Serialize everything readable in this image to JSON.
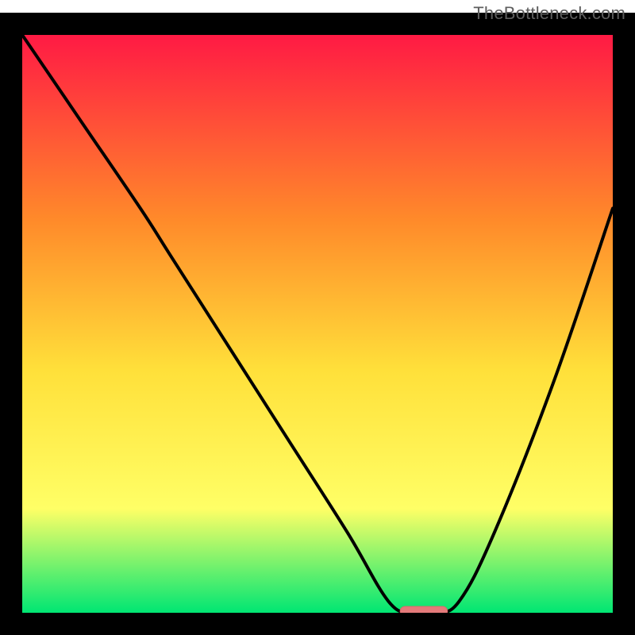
{
  "watermark": "TheBottleneck.com",
  "colors": {
    "frame": "#000000",
    "gradient_top": "#ff1a44",
    "gradient_mid1": "#ff8a2a",
    "gradient_mid2": "#ffe03a",
    "gradient_mid3": "#ffff66",
    "gradient_bottom": "#00e673",
    "curve": "#000000",
    "marker_fill": "#e47a7a",
    "marker_stroke": "#d86a6a"
  },
  "chart_data": {
    "type": "line",
    "title": "",
    "xlabel": "",
    "ylabel": "",
    "xlim": [
      0,
      100
    ],
    "ylim": [
      0,
      100
    ],
    "grid": false,
    "legend": false,
    "series": [
      {
        "name": "bottleneck-curve",
        "x": [
          0,
          10,
          20,
          25,
          35,
          45,
          55,
          62,
          66,
          70,
          74,
          80,
          90,
          100
        ],
        "values": [
          100,
          85,
          70,
          62,
          46,
          30,
          14,
          2,
          0,
          0,
          2,
          14,
          40,
          70
        ]
      }
    ],
    "marker": {
      "name": "optimal-range",
      "x_start": 64,
      "x_end": 72,
      "y": 0
    },
    "annotations": []
  }
}
